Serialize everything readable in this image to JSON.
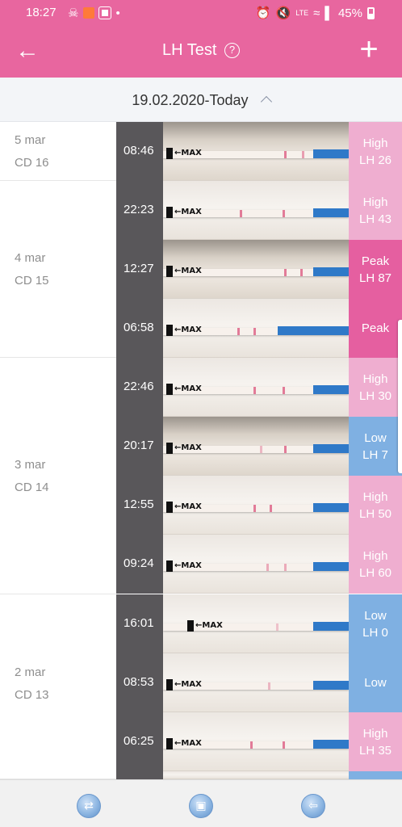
{
  "status_bar": {
    "time": "18:27",
    "battery": "45%",
    "network": "LTE"
  },
  "app_bar": {
    "title": "LH Test",
    "help_icon": "question-circle-icon",
    "back_icon": "arrow-left-icon",
    "add_icon": "plus-icon"
  },
  "range": {
    "label": "19.02.2020-Today",
    "icon": "chevron-up-icon"
  },
  "days": [
    {
      "date": "5 mar",
      "cd": "CD 16"
    },
    {
      "date": "4 mar",
      "cd": "CD 15"
    },
    {
      "date": "3 mar",
      "cd": "CD 14"
    },
    {
      "date": "2 mar",
      "cd": "CD 13"
    }
  ],
  "tests": [
    {
      "time": "08:46",
      "level": "High",
      "value": "LH 26"
    },
    {
      "time": "22:23",
      "level": "High",
      "value": "LH 43"
    },
    {
      "time": "12:27",
      "level": "Peak",
      "value": "LH 87"
    },
    {
      "time": "06:58",
      "level": "Peak",
      "value": ""
    },
    {
      "time": "22:46",
      "level": "High",
      "value": "LH 30"
    },
    {
      "time": "20:17",
      "level": "Low",
      "value": "LH 7"
    },
    {
      "time": "12:55",
      "level": "High",
      "value": "LH 50"
    },
    {
      "time": "09:24",
      "level": "High",
      "value": "LH 60"
    },
    {
      "time": "16:01",
      "level": "Low",
      "value": "LH 0"
    },
    {
      "time": "08:53",
      "level": "Low",
      "value": ""
    },
    {
      "time": "06:25",
      "level": "High",
      "value": "LH 35"
    }
  ],
  "strip_text": "MAX",
  "colors": {
    "accent": "#e8669f",
    "high": "#efaed0",
    "peak": "#e55fa0",
    "low": "#7fb0e2"
  },
  "bottom_nav": {
    "icons": [
      "swap-icon",
      "crop-icon",
      "back-arrow-icon"
    ]
  }
}
